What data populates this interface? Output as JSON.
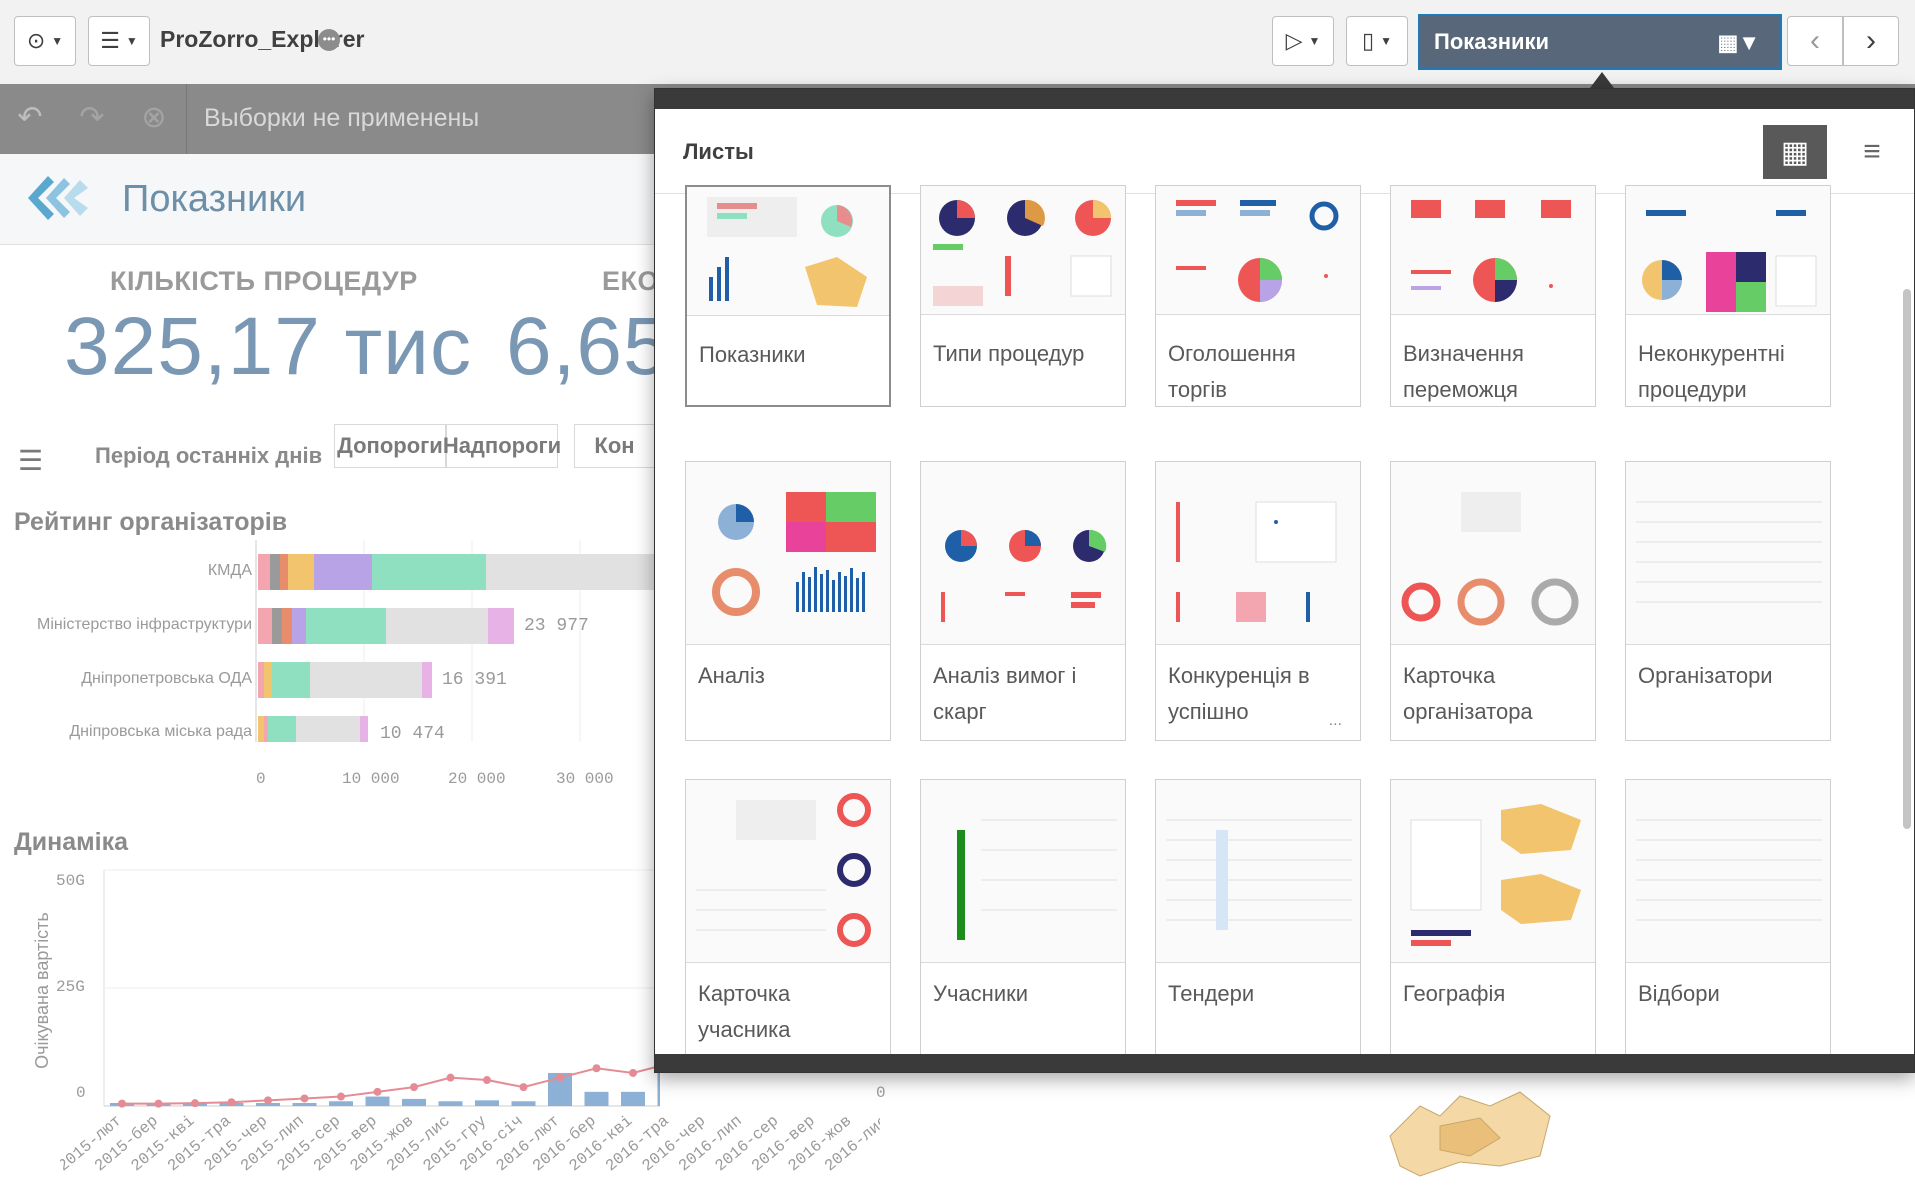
{
  "toolbar": {
    "app_name": "ProZorro_Explorer",
    "current_sheet": "Показники"
  },
  "selections": {
    "status": "Выборки не применены"
  },
  "sheet": {
    "title": "Показники"
  },
  "kpis": [
    {
      "label": "КІЛЬКІСТЬ ПРОЦЕДУР",
      "value": "325,17 тис"
    },
    {
      "label": "ЕКО",
      "value": "6,65"
    }
  ],
  "filters": {
    "period_label": "Період останніх днів",
    "buttons": [
      "Допороги",
      "Надпороги",
      "Кон"
    ]
  },
  "ranking": {
    "title": "Рейтинг організаторів",
    "rows": [
      {
        "name": "КМДА",
        "value": null
      },
      {
        "name": "Міністерство інфраструктури",
        "value": "23 977"
      },
      {
        "name": "Дніпропетровська ОДА",
        "value": "16 391"
      },
      {
        "name": "Дніпровська міська рада",
        "value": "10 474"
      }
    ],
    "x_ticks": [
      "0",
      "10 000",
      "20 000",
      "30 000"
    ]
  },
  "dynamics": {
    "title": "Динаміка",
    "ylabel": "Очікувана вартість",
    "y_ticks": [
      "50G",
      "25G",
      "0"
    ],
    "right_tick": "0",
    "x_labels": [
      "2015-лют",
      "2015-бер",
      "2015-кві",
      "2015-тра",
      "2015-чер",
      "2015-лип",
      "2015-сер",
      "2015-вер",
      "2015-жов",
      "2015-лис",
      "2015-гру",
      "2016-січ",
      "2016-лют",
      "2016-бер",
      "2016-кві",
      "2016-тра",
      "2016-чер",
      "2016-лип",
      "2016-сер",
      "2016-вер",
      "2016-жов",
      "2016-лис"
    ]
  },
  "chart_data": {
    "type": "bar",
    "title": "Динаміка",
    "ylabel": "Очікувана вартість",
    "categories": [
      "2015-лют",
      "2015-бер",
      "2015-кві",
      "2015-тра",
      "2015-чер",
      "2015-лип",
      "2015-сер",
      "2015-вер",
      "2015-жов",
      "2015-лис",
      "2015-гру",
      "2016-січ",
      "2016-лют",
      "2016-бер",
      "2016-кві",
      "2016-тра"
    ],
    "ylim": [
      0,
      50
    ],
    "series": [
      {
        "values": [
          0.3,
          0.3,
          0.3,
          0.4,
          0.5,
          0.6,
          1,
          2,
          1.5,
          1,
          1.2,
          1,
          7,
          3,
          3,
          18
        ]
      }
    ],
    "line": [
      0.5,
      0.5,
      0.6,
      0.8,
      1.2,
      1.6,
      2,
      3,
      4,
      6,
      5.5,
      4,
      6,
      8,
      7,
      9
    ]
  },
  "popover": {
    "title": "Листы",
    "sheets": [
      "Показники",
      "Типи процедур",
      "Оголошення торгів",
      "Визначення переможця",
      "Неконкурентні процедури",
      "Аналіз",
      "Аналіз вимог і скарг",
      "Конкуренція в успішно",
      "Карточка організатора",
      "Організатори",
      "Карточка учасника",
      "Учасники",
      "Тендери",
      "Географія",
      "Відбори"
    ],
    "more": "..."
  },
  "colors": {
    "accent": "#1f7ab8",
    "sheet_select_bg": "#59677a",
    "kpi_value": "#7a97b3",
    "bar_green": "#8fe0c0",
    "bar_purple": "#b8a3e6",
    "bar_pink": "#e7b3e6",
    "bar_blue": "#8db1d6",
    "line_red": "#e58b95"
  }
}
